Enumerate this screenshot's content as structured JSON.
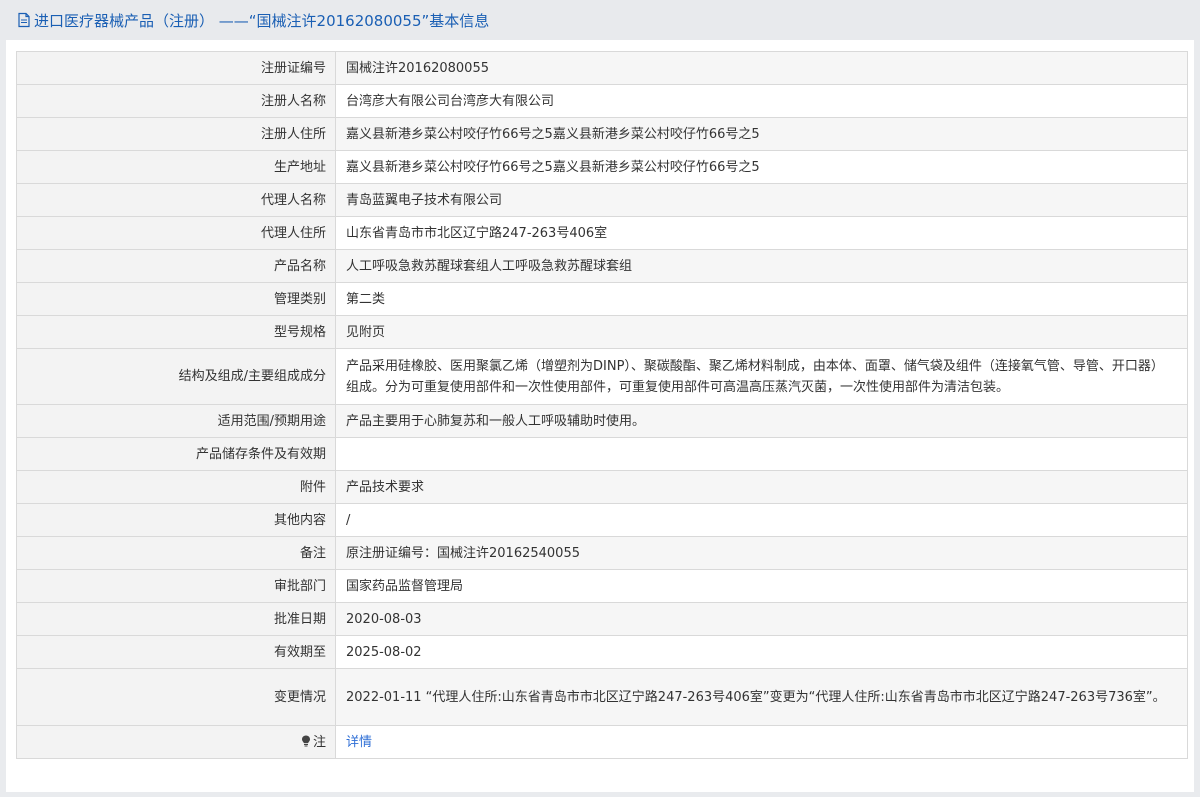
{
  "header": {
    "title": "进口医疗器械产品（注册）  ——“国械注许20162080055”基本信息",
    "icon": "document-icon"
  },
  "rows": [
    {
      "label": "注册证编号",
      "value": "国械注许20162080055"
    },
    {
      "label": "注册人名称",
      "value": "台湾彦大有限公司台湾彦大有限公司"
    },
    {
      "label": "注册人住所",
      "value": "嘉义县新港乡菜公村咬仔竹66号之5嘉义县新港乡菜公村咬仔竹66号之5"
    },
    {
      "label": "生产地址",
      "value": "嘉义县新港乡菜公村咬仔竹66号之5嘉义县新港乡菜公村咬仔竹66号之5"
    },
    {
      "label": "代理人名称",
      "value": "青岛蓝翼电子技术有限公司"
    },
    {
      "label": "代理人住所",
      "value": "山东省青岛市市北区辽宁路247-263号406室"
    },
    {
      "label": "产品名称",
      "value": "人工呼吸急救苏醒球套组人工呼吸急救苏醒球套组"
    },
    {
      "label": "管理类别",
      "value": "第二类"
    },
    {
      "label": "型号规格",
      "value": "见附页"
    },
    {
      "label": "结构及组成/主要组成成分",
      "value": "产品采用硅橡胶、医用聚氯乙烯（增塑剂为DINP）、聚碳酸酯、聚乙烯材料制成，由本体、面罩、储气袋及组件（连接氧气管、导管、开口器）组成。分为可重复使用部件和一次性使用部件，可重复使用部件可高温高压蒸汽灭菌，一次性使用部件为清洁包装。"
    },
    {
      "label": "适用范围/预期用途",
      "value": "产品主要用于心肺复苏和一般人工呼吸辅助时使用。"
    },
    {
      "label": "产品储存条件及有效期",
      "value": ""
    },
    {
      "label": "附件",
      "value": "产品技术要求"
    },
    {
      "label": "其他内容",
      "value": "/"
    },
    {
      "label": "备注",
      "value": "原注册证编号：国械注许20162540055"
    },
    {
      "label": "审批部门",
      "value": "国家药品监督管理局"
    },
    {
      "label": "批准日期",
      "value": "2020-08-03"
    },
    {
      "label": "有效期至",
      "value": "2025-08-02"
    },
    {
      "label": "变更情况",
      "value": "2022-01-11 “代理人住所:山东省青岛市市北区辽宁路247-263号406室”变更为“代理人住所:山东省青岛市市北区辽宁路247-263号736室”。"
    }
  ],
  "note": {
    "label": "注",
    "icon": "lightbulb-icon",
    "link": "详情"
  },
  "colors": {
    "link": "#2f6fd6",
    "header_text": "#1a5fb4"
  }
}
